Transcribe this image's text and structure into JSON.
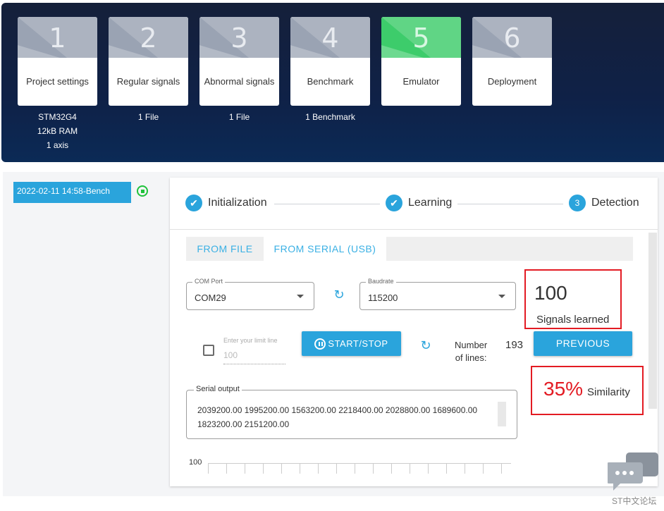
{
  "steps": [
    {
      "number": "1",
      "label": "Project settings",
      "info": [
        "STM32G4",
        "12kB RAM",
        "1 axis"
      ]
    },
    {
      "number": "2",
      "label": "Regular signals",
      "info": [
        "1 File"
      ]
    },
    {
      "number": "3",
      "label": "Abnormal signals",
      "info": [
        "1 File"
      ]
    },
    {
      "number": "4",
      "label": "Benchmark",
      "info": [
        "1 Benchmark"
      ]
    },
    {
      "number": "5",
      "label": "Emulator",
      "info": [],
      "active": true
    },
    {
      "number": "6",
      "label": "Deployment",
      "info": []
    }
  ],
  "sidebar": {
    "bench_item": "2022-02-11 14:58-Bench",
    "status_icon": "stop-circle-icon"
  },
  "stepper": {
    "items": [
      {
        "label": "Initialization",
        "state": "done"
      },
      {
        "label": "Learning",
        "state": "done"
      },
      {
        "label": "Detection",
        "state": "current",
        "number": "3"
      }
    ]
  },
  "tabs": [
    "FROM FILE",
    "FROM SERIAL (USB)"
  ],
  "com_port": {
    "label": "COM Port",
    "value": "COM29"
  },
  "baudrate": {
    "label": "Baudrate",
    "value": "115200"
  },
  "signals_learned": {
    "value": "100",
    "label": "Signals learned"
  },
  "limit_line": {
    "label": "Enter your limit line",
    "placeholder": "100"
  },
  "start_stop_label": "START/STOP",
  "number_of_lines": {
    "label_line1": "Number",
    "label_line2": "of lines:",
    "value": "193"
  },
  "previous_label": "PREVIOUS",
  "serial_output": {
    "label": "Serial output",
    "text": "2039200.00 1995200.00 1563200.00 2218400.00 2028800.00 1689600.00 1823200.00 2151200.00"
  },
  "similarity": {
    "value": "35%",
    "label": "Similarity"
  },
  "chart": {
    "y_tick": "100"
  },
  "watermark": "ST中文论坛",
  "colors": {
    "accent": "#2aa4dc",
    "highlight": "#e31b23",
    "active_step": "#3dcc6b",
    "status": "#1fc23b"
  }
}
